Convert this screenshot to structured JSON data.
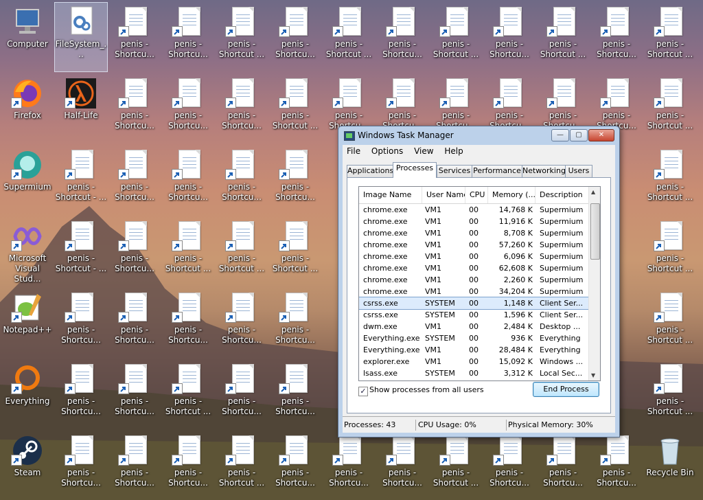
{
  "desktop": {
    "columns": [
      [
        "Computer",
        "Firefox",
        "Supermium",
        "Microsoft Visual Stud...",
        "Notepad++",
        "Everything",
        "Steam"
      ],
      [
        "FileSystem_...",
        "Half-Life",
        "penis - Shortcut - ...",
        "penis - Shortcut - ...",
        "penis - Shortcu...",
        "penis - Shortcu...",
        "penis - Shortcu..."
      ],
      [
        "penis - Shortcu...",
        "penis - Shortcu...",
        "penis - Shortcu...",
        "penis - Shortcu...",
        "penis - Shortcu...",
        "penis - Shortcu...",
        "penis - Shortcu..."
      ],
      [
        "penis - Shortcu...",
        "penis - Shortcu...",
        "penis - Shortcu...",
        "penis - Shortcut ...",
        "penis - Shortcu...",
        "penis - Shortcut ...",
        "penis - Shortcu..."
      ],
      [
        "penis - Shortcut ...",
        "penis - Shortcu...",
        "penis - Shortcu...",
        "penis - Shortcut ...",
        "penis - Shortcu...",
        "penis - Shortcu...",
        "penis - Shortcut ..."
      ],
      [
        "penis - Shortcu...",
        "penis - Shortcut ...",
        "penis - Shortcu...",
        "penis - Shortcut ...",
        "penis - Shortcu...",
        "penis - Shortcu...",
        "penis - Shortcu..."
      ],
      [
        "penis - Shortcut ...",
        "penis - Shortcu...",
        "",
        "",
        "",
        "",
        "penis - Shortcu..."
      ],
      [
        "penis - Shortcu...",
        "penis - Shortcu...",
        "",
        "",
        "",
        "",
        "penis - Shortcu..."
      ],
      [
        "penis - Shortcut ...",
        "penis - Shortcu...",
        "",
        "",
        "",
        "",
        "penis - Shortcut ..."
      ],
      [
        "penis - Shortcu...",
        "penis - Shortcu...",
        "",
        "",
        "",
        "",
        "penis - Shortcu..."
      ],
      [
        "penis - Shortcut ...",
        "penis - Shortcu...",
        "",
        "",
        "",
        "",
        "penis - Shortcu..."
      ],
      [
        "penis - Shortcu...",
        "penis - Shortcu...",
        "",
        "",
        "",
        "",
        "penis - Shortcu..."
      ],
      [
        "penis - Shortcut ...",
        "penis - Shortcut ...",
        "penis - Shortcut ...",
        "penis - Shortcut ...",
        "penis - Shortcut ...",
        "penis - Shortcut ...",
        "Recycle Bin"
      ]
    ]
  },
  "taskmanager": {
    "title": "Windows Task Manager",
    "window_buttons": {
      "minimize": "—",
      "maximize": "▢",
      "close": "✕"
    },
    "menu": [
      "File",
      "Options",
      "View",
      "Help"
    ],
    "tabs": [
      "Applications",
      "Processes",
      "Services",
      "Performance",
      "Networking",
      "Users"
    ],
    "active_tab": "Processes",
    "columns": [
      "Image Name",
      "User Name",
      "CPU",
      "Memory (...",
      "Description"
    ],
    "processes": [
      [
        "chrome.exe",
        "VM1",
        "00",
        "14,768 K",
        "Supermium"
      ],
      [
        "chrome.exe",
        "VM1",
        "00",
        "11,916 K",
        "Supermium"
      ],
      [
        "chrome.exe",
        "VM1",
        "00",
        "8,708 K",
        "Supermium"
      ],
      [
        "chrome.exe",
        "VM1",
        "00",
        "57,260 K",
        "Supermium"
      ],
      [
        "chrome.exe",
        "VM1",
        "00",
        "6,096 K",
        "Supermium"
      ],
      [
        "chrome.exe",
        "VM1",
        "00",
        "62,608 K",
        "Supermium"
      ],
      [
        "chrome.exe",
        "VM1",
        "00",
        "2,260 K",
        "Supermium"
      ],
      [
        "chrome.exe",
        "VM1",
        "00",
        "34,204 K",
        "Supermium"
      ],
      [
        "csrss.exe",
        "SYSTEM",
        "00",
        "1,148 K",
        "Client Ser..."
      ],
      [
        "csrss.exe",
        "SYSTEM",
        "00",
        "1,596 K",
        "Client Ser..."
      ],
      [
        "dwm.exe",
        "VM1",
        "00",
        "2,484 K",
        "Desktop ..."
      ],
      [
        "Everything.exe",
        "SYSTEM",
        "00",
        "936 K",
        "Everything"
      ],
      [
        "Everything.exe",
        "VM1",
        "00",
        "28,484 K",
        "Everything"
      ],
      [
        "explorer.exe",
        "VM1",
        "00",
        "15,092 K",
        "Windows ..."
      ],
      [
        "lsass.exe",
        "SYSTEM",
        "00",
        "3,312 K",
        "Local Sec..."
      ]
    ],
    "selected_process": "csrss.exe",
    "show_all_users_label": "Show processes from all users",
    "show_all_users_checked": "✓",
    "end_process_label": "End Process",
    "status": {
      "processes": "Processes: 43",
      "cpu": "CPU Usage: 0%",
      "memory": "Physical Memory: 30%"
    }
  }
}
